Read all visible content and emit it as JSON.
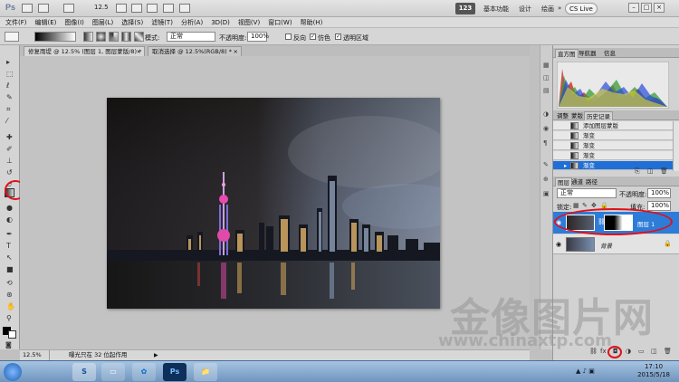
{
  "app": {
    "logo": "Ps",
    "zoom_display": "12.5",
    "workspace_badge": "123",
    "workspaces": [
      "基本功能",
      "设计",
      "绘画"
    ],
    "more": "»",
    "cs_live": "CS Live",
    "win_controls": [
      "–",
      "□",
      "×"
    ]
  },
  "menu": [
    "文件(F)",
    "编辑(E)",
    "图像(I)",
    "图层(L)",
    "选择(S)",
    "滤镜(T)",
    "分析(A)",
    "3D(D)",
    "视图(V)",
    "窗口(W)",
    "帮助(H)"
  ],
  "options": {
    "mode_label": "模式:",
    "mode_value": "正常",
    "opacity_label": "不透明度:",
    "opacity_value": "100%",
    "reverse_label": "反向",
    "dither_label": "仿色",
    "transparency_label": "透明区域"
  },
  "doc_tabs": [
    {
      "title": "修复雨堤 @ 12.5% (图层 1, 图层蒙版/8) *",
      "close": "×"
    },
    {
      "title": "取消选择 @ 12.5%(RGB/8) *",
      "close": "×"
    }
  ],
  "status": {
    "zoom": "12.5%",
    "info": "曝光只在 32 位起作用"
  },
  "panels": {
    "histogram_tabs": [
      "直方图",
      "导航器",
      "信息"
    ],
    "history_tabs": [
      "调整",
      "蒙版",
      "历史记录"
    ],
    "history_items": [
      "添加图层蒙版",
      "渐变",
      "渐变",
      "渐变",
      "渐变"
    ],
    "layers_tabs": [
      "图层",
      "通道",
      "路径"
    ],
    "blend_mode": "正常",
    "opacity_label": "不透明度:",
    "opacity_value": "100%",
    "lock_label": "锁定:",
    "fill_label": "填充:",
    "fill_value": "100%",
    "layers": [
      {
        "name": "图层 1"
      },
      {
        "name": "背景"
      }
    ],
    "fx_label": "fx"
  },
  "taskbar": {
    "time": "17:10",
    "date": "2015/5/18",
    "ps_label": "Ps"
  },
  "watermark": {
    "text": "金像图片网",
    "url": "www.chinaxtp.com"
  },
  "colors": {
    "accent_select": "#1f6fd6",
    "highlight_oval": "#e0101a"
  }
}
